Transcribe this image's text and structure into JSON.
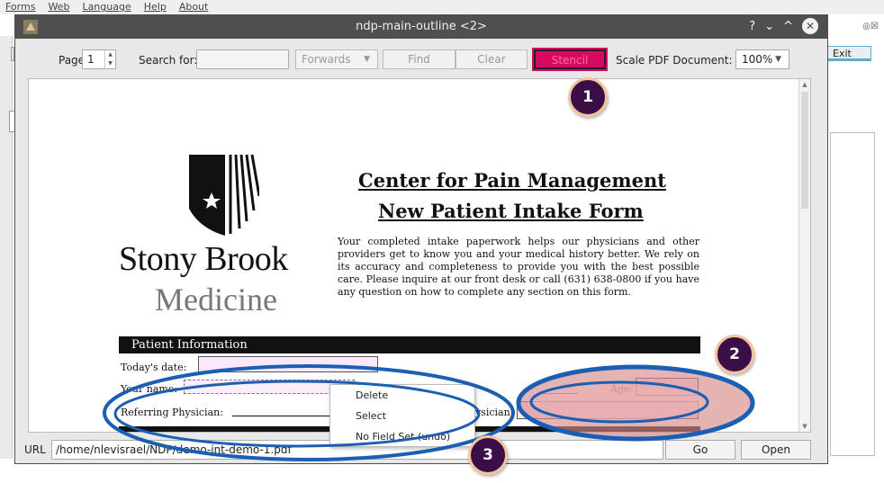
{
  "bg_menubar": [
    "Forms",
    "Web",
    "Language",
    "Help",
    "About"
  ],
  "bg_right_controls": "◎☒",
  "bg_exit_label": "Exit",
  "window": {
    "title": "ndp-main-outline <2>",
    "controls": [
      "?",
      "⌄",
      "^"
    ]
  },
  "toolbar": {
    "page_label": "Page:",
    "page_value": "1",
    "search_label": "Search for:",
    "search_value": "",
    "direction": "Forwards",
    "find_label": "Find",
    "clear_label": "Clear",
    "stencil_label": "Stencil",
    "scale_label": "Scale PDF Document:",
    "scale_value": "100%"
  },
  "document": {
    "logo_name": "Stony Brook",
    "logo_sub": "Medicine",
    "heading_line1": "Center for Pain Management",
    "heading_line2": "New Patient Intake Form",
    "intro": "Your completed intake paperwork helps our physicians and other providers get to know you and your medical history better. We rely on its accuracy and completeness to provide you with the best possible care. Please inquire at our front desk or call (631) 638-0800 if you have any question on how to complete any section on this form.",
    "section_title": "Patient Information",
    "fields": {
      "todays_date": "Today's date:",
      "your_name": "Your name:",
      "referring_physician": "Referring Physician:",
      "age": "Age:",
      "physician_partial": "ysician:"
    }
  },
  "context_menu": [
    "Delete",
    "Select",
    "No Field Set (undo)"
  ],
  "url": {
    "label": "URL",
    "value": "/home/nlevisrael/NDP/demo-int-demo-1.pdf",
    "go_label": "Go",
    "open_label": "Open"
  },
  "annotations": {
    "badge1": "1",
    "badge2": "2",
    "badge3": "3",
    "ellipse_color": "#1a5fb4",
    "ellipse_fill": "#d98a8a"
  }
}
